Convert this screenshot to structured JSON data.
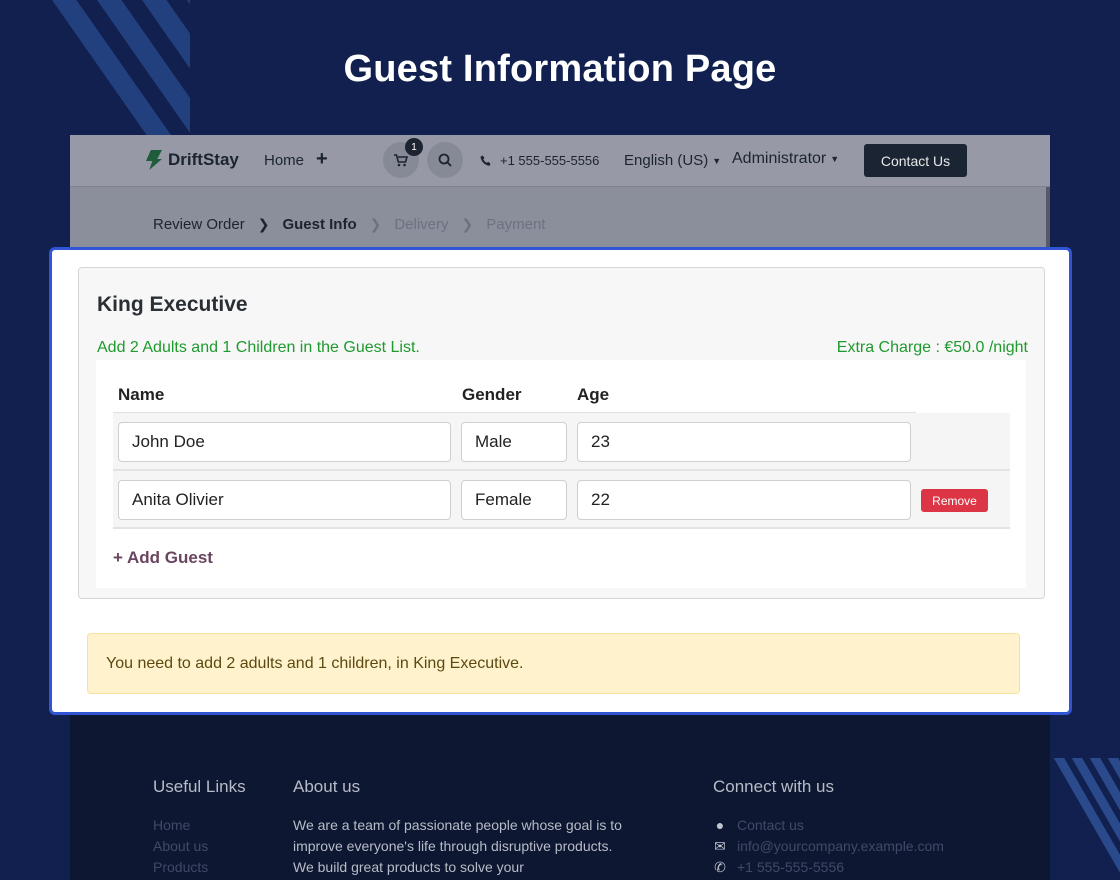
{
  "heading": "Guest Information Page",
  "navbar": {
    "brand": "DriftStay",
    "home_label": "Home",
    "plus_label": "+",
    "cart_count": "1",
    "phone": "+1 555-555-5556",
    "language": "English (US)",
    "user": "Administrator",
    "contact_label": "Contact Us"
  },
  "breadcrumb": {
    "steps": [
      "Review Order",
      "Guest Info",
      "Delivery",
      "Payment"
    ],
    "active_index": 1
  },
  "room": {
    "name": "King Executive",
    "guest_note": "Add 2 Adults and 1 Children in the Guest List.",
    "extra_charge": "Extra Charge : €50.0 /night"
  },
  "table": {
    "headers": {
      "name": "Name",
      "gender": "Gender",
      "age": "Age"
    },
    "rows": [
      {
        "name": "John Doe",
        "gender": "Male",
        "age": "23"
      },
      {
        "name": "Anita Olivier",
        "gender": "Female",
        "age": "22",
        "remove_label": "Remove"
      }
    ]
  },
  "add_guest_label": "+ Add Guest",
  "alert_text": "You need to add 2 adults and 1 children, in King Executive.",
  "footer": {
    "useful_links_title": "Useful Links",
    "useful_links": [
      "Home",
      "About us",
      "Products"
    ],
    "about_title": "About us",
    "about_text": "We are a team of passionate people whose goal is to improve everyone's life through disruptive products. We build great products to solve your",
    "connect_title": "Connect with us",
    "connect": [
      {
        "icon": "comment-icon",
        "label": "Contact us"
      },
      {
        "icon": "envelope-icon",
        "label": "info@yourcompany.example.com"
      },
      {
        "icon": "phone-icon",
        "label": "+1 555-555-5556"
      }
    ]
  },
  "colors": {
    "background": "#11204f",
    "modal_border": "#2f55d4",
    "success_text": "#1f9a2e",
    "remove": "#dc3545",
    "alert_bg": "#fff2cc"
  }
}
